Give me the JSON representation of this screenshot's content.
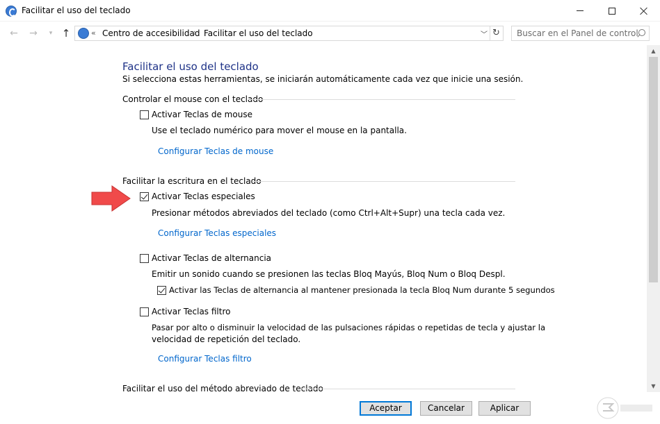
{
  "window": {
    "title": "Facilitar el uso del teclado"
  },
  "navbar": {
    "breadcrumb_prefix": "«",
    "breadcrumbs": [
      "Centro de accesibilidad",
      "Facilitar el uso del teclado"
    ],
    "breadcrumb_separator": "›",
    "search_placeholder": "Buscar en el Panel de control"
  },
  "page": {
    "heading": "Facilitar el uso del teclado",
    "subtitle": "Si selecciona estas herramientas, se iniciarán automáticamente cada vez que inicie una sesión.",
    "sections": {
      "mouse": {
        "title": "Controlar el mouse con el teclado",
        "option_label": "Activar Teclas de mouse",
        "option_checked": false,
        "description": "Use el teclado numérico para mover el mouse en la pantalla.",
        "link": "Configurar Teclas de mouse"
      },
      "typing": {
        "title": "Facilitar la escritura en el teclado",
        "sticky_label": "Activar Teclas especiales",
        "sticky_checked": true,
        "sticky_description": "Presionar métodos abreviados del teclado (como Ctrl+Alt+Supr) una tecla cada vez.",
        "sticky_link": "Configurar Teclas especiales",
        "toggle_label": "Activar Teclas de alternancia",
        "toggle_checked": false,
        "toggle_description": "Emitir un sonido cuando se presionen las teclas Bloq Mayús, Bloq Num o Bloq Despl.",
        "toggle_sub_label": "Activar las Teclas de alternancia al mantener presionada la tecla Bloq Num durante 5 segundos",
        "toggle_sub_checked": true,
        "filter_label": "Activar Teclas filtro",
        "filter_checked": false,
        "filter_description_1": "Pasar por alto o disminuir la velocidad de las pulsaciones rápidas o repetidas de tecla y ajustar la",
        "filter_description_2": "velocidad de repetición del teclado.",
        "filter_link": "Configurar Teclas filtro"
      },
      "shortcuts": {
        "title": "Facilitar el uso del método abreviado de teclado"
      }
    }
  },
  "footer": {
    "accept": "Aceptar",
    "cancel": "Cancelar",
    "apply": "Aplicar"
  },
  "colors": {
    "heading": "#1e3287",
    "link": "#0066cc",
    "annotation_arrow": "#f04a4a",
    "default_button_border": "#0078d7"
  }
}
